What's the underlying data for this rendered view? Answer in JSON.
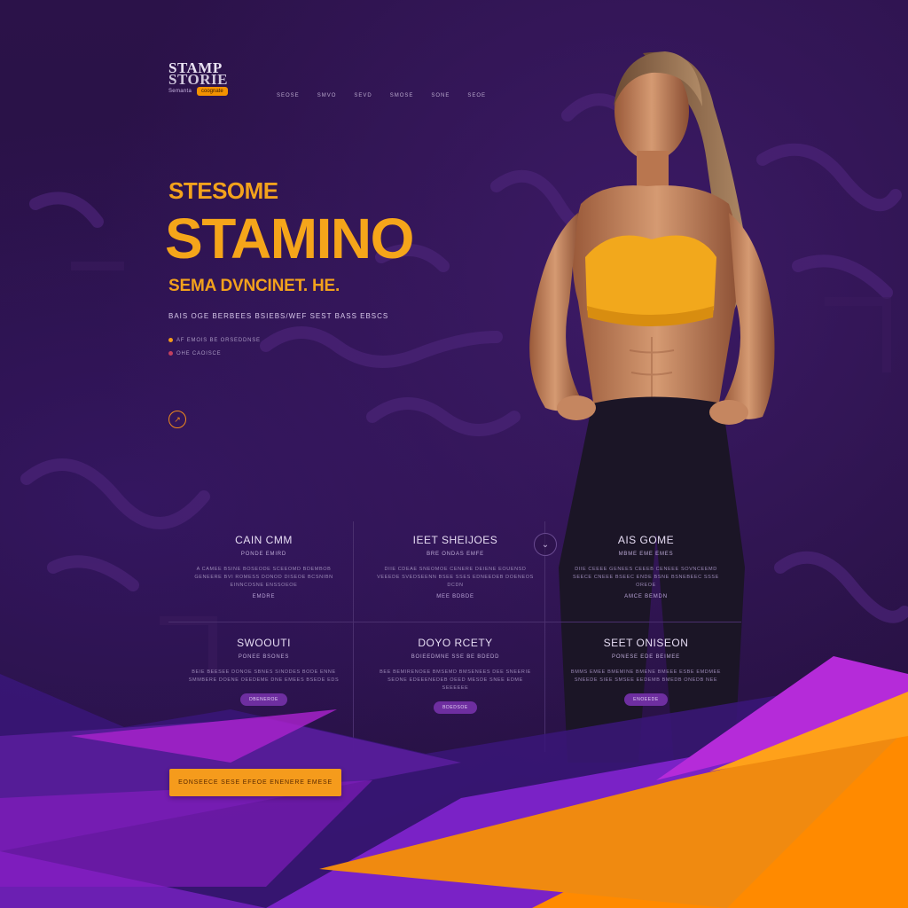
{
  "logo": {
    "line1": "STAMP",
    "line2": "STORIE",
    "tag_left": "Semanta",
    "badge": "coognate"
  },
  "nav": {
    "items": [
      "SEOSE",
      "SMVO",
      "SEVD",
      "SMOSE",
      "SONE",
      "SEOE"
    ]
  },
  "hero": {
    "pretitle": "STESOME",
    "title": "STAMINO",
    "subtitle": "SEMA DVNCINET. HE.",
    "tagline": "BAIS OGE BERBEES BSIEBS/WEF SEST BASS EBSCS",
    "bullets": [
      {
        "text": "AF EMOIS BE ORSEDDNSE",
        "color": "#f39a1a"
      },
      {
        "text": "OHE CAOISCE",
        "color": "#c23f5e"
      }
    ],
    "play_icon": "arrow-icon"
  },
  "features": [
    {
      "title": "CAIN CMM",
      "subtitle": "PONDE EMIRD",
      "body": "A CAMEE BSINE BOSEODE SCEEOMD BDEMBOB GENEERE BVI ROMESS DONOD DISEOE BCSNIBN EINNCOSNE ENSSOEOE",
      "link": "EMDRE"
    },
    {
      "title": "IEET SHEIJOES",
      "subtitle": "BRE ONDAS EMFE",
      "body": "DIIE CDEAE SNEOMOE CENERE DEIENE EOUENSD VEEEDE SVEDSEENN BSEE SSES EDNEEDEB DOENEOS DCDN",
      "link": "MEE BDBDE"
    },
    {
      "title": "AIS GOME",
      "subtitle": "MBME EME EMES",
      "body": "DIIE CEEEE GENEES CEEEB CENEEE SOVNCEEMD SEECE CNEEE BSEEC ENDE BSNE BSNEBEEC SSSE OREOE",
      "link": "AMCE BEMDN"
    },
    {
      "title": "SWOOUTI",
      "subtitle": "PONEE BSONES",
      "body": "BEIE BEESEE DONOE SBNES SINDDES BODE ENNE SMMBERE DOENE OEEDEME DNE EMEES BSEDE EDS",
      "button": "DBENEROE"
    },
    {
      "title": "DOYO RCETY",
      "subtitle": "BOIEEDMNE SSE BE BDEDD",
      "body": "BEE BEMIRENOEE BMSEMD BMSENEES DEE SNEERIE SEONE EDEEENEDEB OEED MESDE SNEE EDME SEEEEEE",
      "button": "BDEDSOE"
    },
    {
      "title": "SEET ONISEON",
      "subtitle": "PONESE EDE BEIMEE",
      "body": "BMMS EMEE BMEMINE BMENE BMEEE ESBE EMDMEE SNEEDE SIEE SMSEE EEDEMB BMEDB ONEDB NEE",
      "button": "ENOEEDE"
    }
  ],
  "chevron_icon": "chevron-down-icon",
  "cta": {
    "label": "EONSEECE SESE EFEOE ENENERE  EMESE"
  },
  "colors": {
    "background": "#2a1247",
    "accent_orange": "#f5a51a",
    "accent_purple": "#8e2bd6",
    "magenta": "#c12ad8"
  }
}
